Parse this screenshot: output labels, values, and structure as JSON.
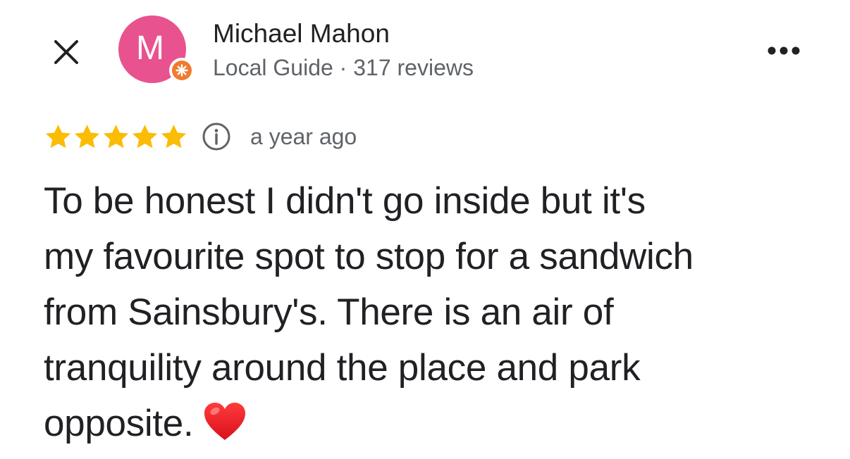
{
  "header": {
    "close_icon": "close-icon",
    "more_icon": "more-options-icon"
  },
  "reviewer": {
    "avatar_letter": "M",
    "avatar_color": "#e8528f",
    "badge_icon": "local-guide-star-icon",
    "badge_color": "#f07a2e",
    "name": "Michael Mahon",
    "meta": "Local Guide · 317 reviews"
  },
  "review": {
    "rating": 5,
    "rating_max": 5,
    "star_color": "#fbbc04",
    "info_icon": "info-icon",
    "date": "a year ago",
    "text_lines": [
      "To be honest I didn't go inside but it's",
      "my favourite spot to stop for a sandwich",
      "from Sainsbury's. There is an air of",
      "tranquility around the place and park",
      "opposite."
    ],
    "trailing_emoji": "red-heart-icon"
  }
}
